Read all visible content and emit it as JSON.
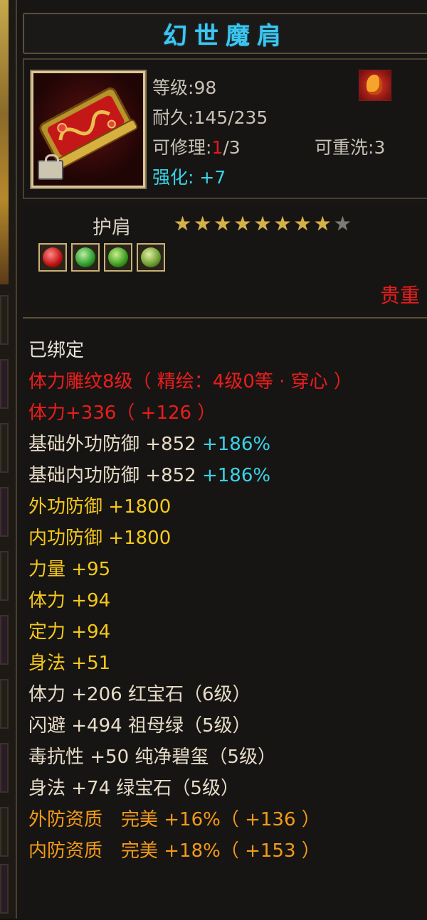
{
  "item": {
    "name": "幻世魔肩",
    "level_label": "等级",
    "level": "98",
    "durability_label": "耐久",
    "durability": "145/235",
    "repair_label": "可修理",
    "repair_used": "1",
    "repair_total": "/3",
    "reforge_label": "可重洗",
    "reforge": "3",
    "enhance_label": "强化",
    "enhance": "+7",
    "type": "护肩",
    "stars_total": 9,
    "stars_lit": 8,
    "rarity": "贵重"
  },
  "gems": [
    "red-gem-icon",
    "green-gem-icon",
    "green-gem-icon",
    "jade-gem-icon"
  ],
  "colors": {
    "title": "#3fc6ee",
    "red": "#ea1d1d",
    "cyan": "#39d3e8",
    "yellow": "#f4c81c",
    "orange": "#f39a1a",
    "star": "#d4b24a"
  },
  "attributes": {
    "bound": "已绑定",
    "engrave": "体力雕纹8级（ 精绘：4级0等 · 穿心 ）",
    "stamina_engrave": "体力+336（ +126 ）",
    "base_outer_def": "基础外功防御",
    "base_outer_def_val": "+852",
    "base_outer_def_pct": "+186%",
    "base_inner_def": "基础内功防御",
    "base_inner_def_val": "+852",
    "base_inner_def_pct": "+186%",
    "outer_def": "外功防御",
    "outer_def_val": "+1800",
    "inner_def": "内功防御",
    "inner_def_val": "+1800",
    "strength": "力量",
    "strength_val": "+95",
    "stamina": "体力",
    "stamina_val": "+94",
    "focus": "定力",
    "focus_val": "+94",
    "agility": "身法",
    "agility_val": "+51",
    "gem1": "体力 +206 红宝石（6级）",
    "gem2": "闪避 +494 祖母绿（5级）",
    "gem3": "毒抗性 +50 纯净碧玺（5级）",
    "gem4": "身法 +74 绿宝石（5级）",
    "quality1": "外防资质　完美 +16%（ +136 ）",
    "quality2": "内防资质　完美 +18%（ +153 ）"
  }
}
